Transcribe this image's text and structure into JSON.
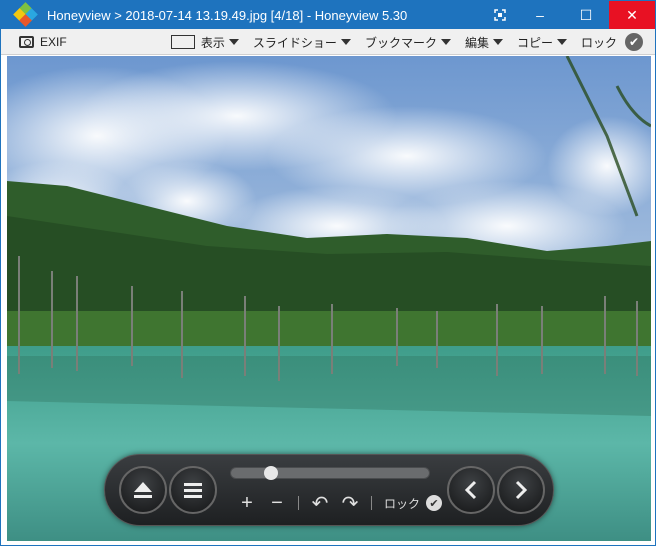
{
  "window": {
    "title": "Honeyview > 2018-07-14 13.19.49.jpg [4/18] - Honeyview 5.30",
    "controls": {
      "fullscreen_icon": "fullscreen-icon",
      "minimize": "–",
      "maximize": "☐",
      "close": "✕"
    }
  },
  "toolbar": {
    "exif_label": "EXIF",
    "menus": [
      {
        "label": "表示",
        "icon": "view-icon"
      },
      {
        "label": "スライドショー"
      },
      {
        "label": "ブックマーク"
      },
      {
        "label": "編集"
      },
      {
        "label": "コピー"
      }
    ],
    "lock_label": "ロック"
  },
  "overlay": {
    "progress": 0.18,
    "zoom_in": "+",
    "zoom_out": "−",
    "rotate_left": "↶",
    "rotate_right": "↷",
    "lock_label": "ロック",
    "eject_icon": "eject-icon",
    "menu_icon": "menu-icon",
    "prev_icon": "chevron-left-icon",
    "next_icon": "chevron-right-icon"
  },
  "colors": {
    "titlebar": "#1e73be",
    "close": "#e81123",
    "sky": "#7ea6d6",
    "water": "#4fa89a",
    "forest": "#2f5d2b"
  }
}
